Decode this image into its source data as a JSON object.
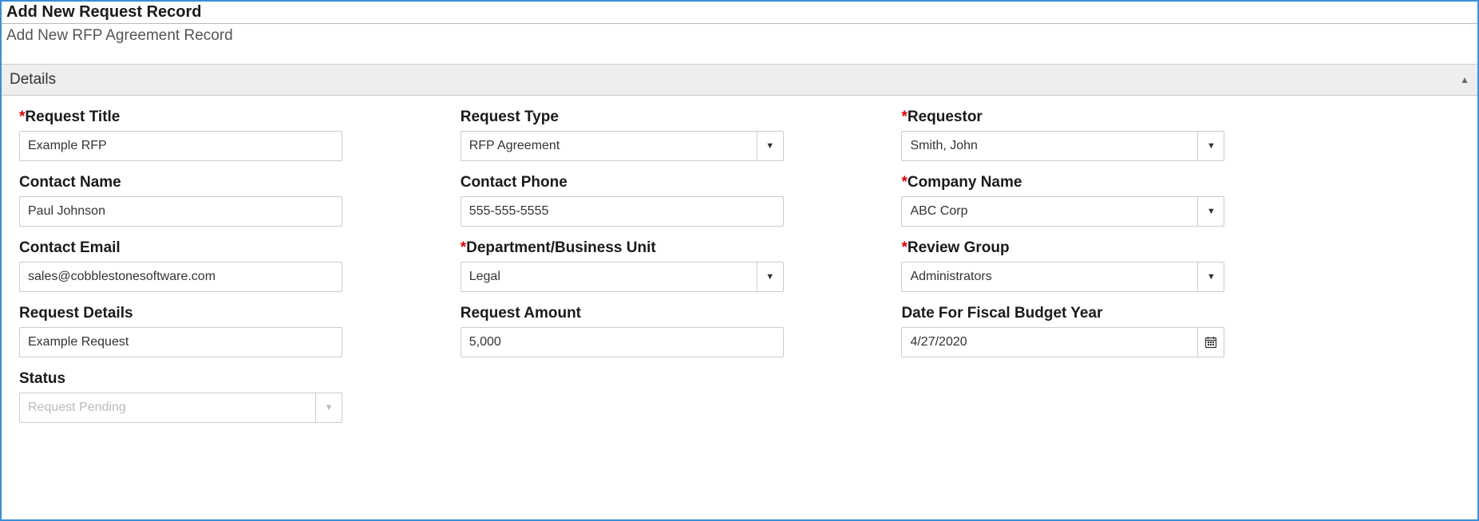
{
  "header": {
    "title": "Add New Request Record",
    "subtitle": "Add New RFP Agreement Record"
  },
  "section": {
    "title": "Details"
  },
  "fields": {
    "request_title": {
      "label": "Request Title",
      "value": "Example RFP",
      "required": true
    },
    "request_type": {
      "label": "Request Type",
      "value": "RFP Agreement",
      "required": false
    },
    "requestor": {
      "label": "Requestor",
      "value": "Smith, John",
      "required": true
    },
    "contact_name": {
      "label": "Contact Name",
      "value": "Paul Johnson",
      "required": false
    },
    "contact_phone": {
      "label": "Contact Phone",
      "value": "555-555-5555",
      "required": false
    },
    "company_name": {
      "label": "Company Name",
      "value": "ABC Corp",
      "required": true
    },
    "contact_email": {
      "label": "Contact Email",
      "value": "sales@cobblestonesoftware.com",
      "required": false
    },
    "department": {
      "label": "Department/Business Unit",
      "value": "Legal",
      "required": true
    },
    "review_group": {
      "label": "Review Group",
      "value": "Administrators",
      "required": true
    },
    "request_details": {
      "label": "Request Details",
      "value": "Example Request",
      "required": false
    },
    "request_amount": {
      "label": "Request Amount",
      "value": "5,000",
      "required": false
    },
    "fiscal_date": {
      "label": "Date For Fiscal Budget Year",
      "value": "4/27/2020",
      "required": false
    },
    "status": {
      "label": "Status",
      "value": "Request Pending",
      "required": false
    }
  }
}
